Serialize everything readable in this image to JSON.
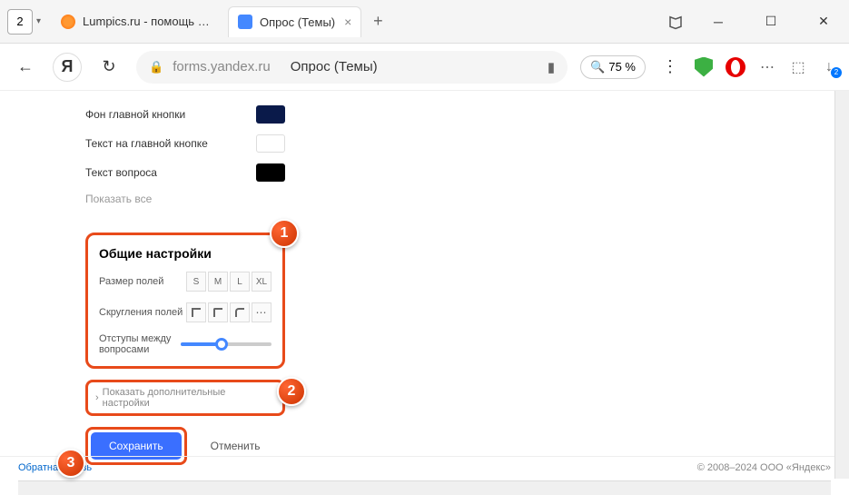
{
  "window": {
    "tab_count": "2",
    "tabs": [
      {
        "title": "Lumpics.ru - помощь с ко",
        "active": false
      },
      {
        "title": "Опрос (Темы)",
        "active": true
      }
    ]
  },
  "address": {
    "domain": "forms.yandex.ru",
    "title": "Опрос (Темы)",
    "zoom": "75 %"
  },
  "colors": {
    "main_button_bg": "Фон главной кнопки",
    "main_button_text": "Текст на главной кнопке",
    "question_text": "Текст вопроса",
    "show_all": "Показать все"
  },
  "settings": {
    "title": "Общие настройки",
    "field_size_label": "Размер полей",
    "sizes": [
      "S",
      "M",
      "L",
      "XL"
    ],
    "corner_label": "Скругления полей",
    "spacing_label": "Отступы между вопросами",
    "more_label": "Показать дополнительные настройки",
    "save": "Сохранить",
    "cancel": "Отменить"
  },
  "callouts": {
    "c1": "1",
    "c2": "2",
    "c3": "3"
  },
  "footer": {
    "feedback": "Обратная связь",
    "copyright": "© 2008–2024  ООО «Яндекс»"
  }
}
